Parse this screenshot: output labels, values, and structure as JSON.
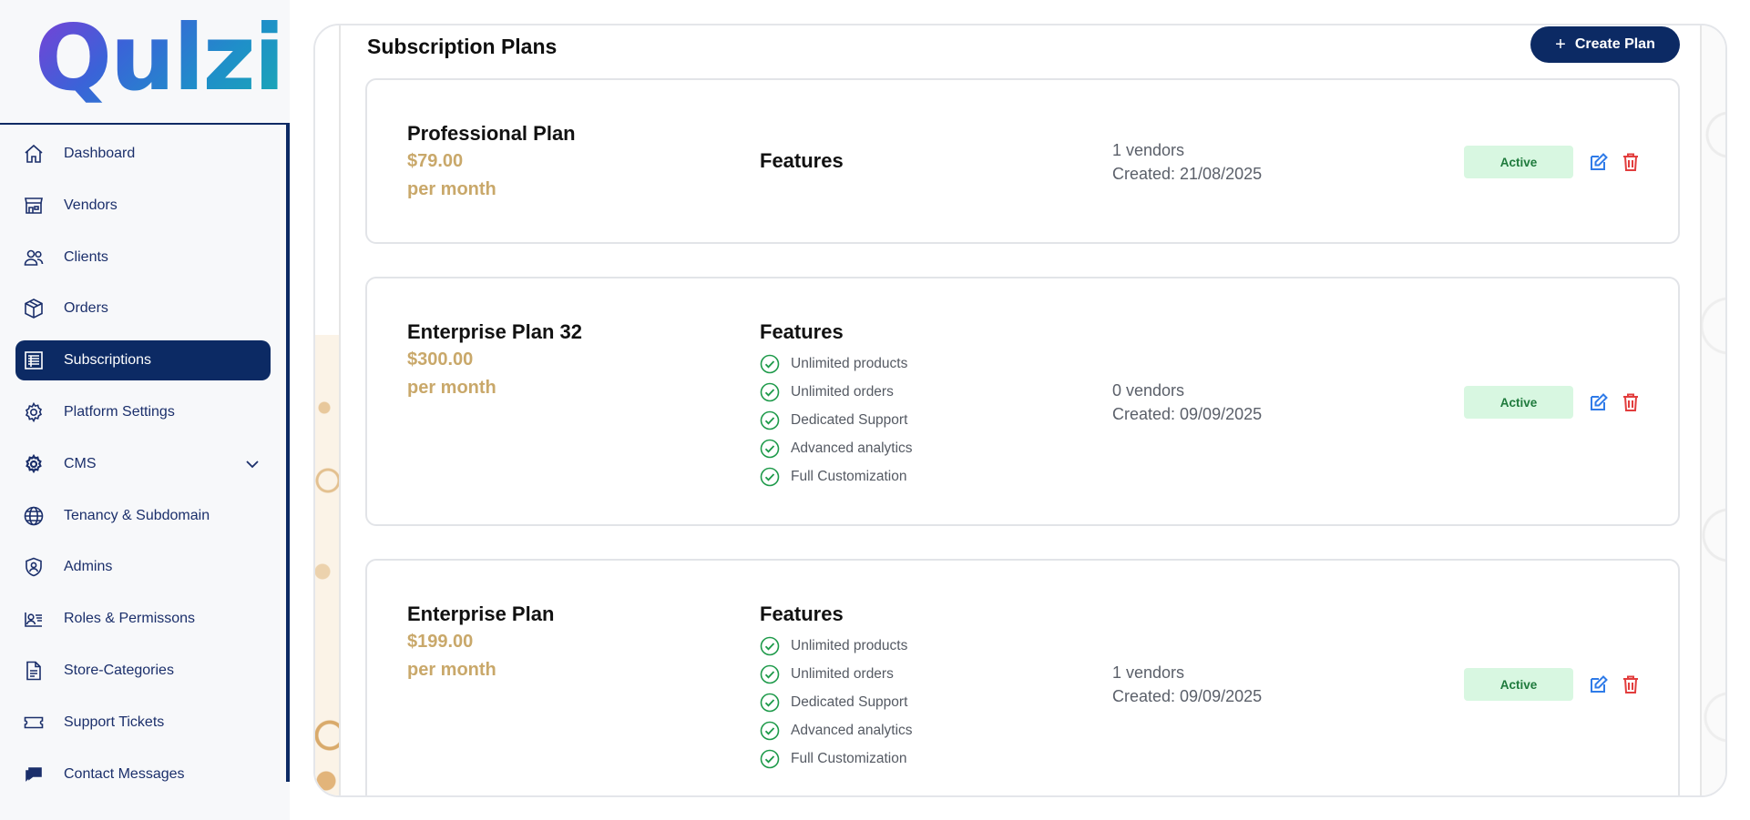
{
  "brand": {
    "logo_text": "Qulzi"
  },
  "sidebar": {
    "items": [
      {
        "label": "Dashboard",
        "icon": "home-icon",
        "active": false
      },
      {
        "label": "Vendors",
        "icon": "store-icon",
        "active": false
      },
      {
        "label": "Clients",
        "icon": "users-icon",
        "active": false
      },
      {
        "label": "Orders",
        "icon": "box-icon",
        "active": false
      },
      {
        "label": "Subscriptions",
        "icon": "receipt-icon",
        "active": true
      },
      {
        "label": "Platform Settings",
        "icon": "gear-icon",
        "active": false
      },
      {
        "label": "CMS",
        "icon": "gear-icon",
        "active": false,
        "has_submenu": true
      },
      {
        "label": "Tenancy & Subdomain",
        "icon": "globe-icon",
        "active": false
      },
      {
        "label": "Admins",
        "icon": "shield-user-icon",
        "active": false
      },
      {
        "label": "Roles & Permissons",
        "icon": "id-card-icon",
        "active": false
      },
      {
        "label": "Store-Categories",
        "icon": "document-icon",
        "active": false
      },
      {
        "label": "Support Tickets",
        "icon": "ticket-icon",
        "active": false
      },
      {
        "label": "Contact Messages",
        "icon": "chat-icon",
        "active": false
      }
    ]
  },
  "main": {
    "title": "Subscription Plans",
    "create_button_label": "Create Plan",
    "plans": [
      {
        "name": "Professional Plan",
        "price": "$79.00",
        "period": "per month",
        "features_title": "Features",
        "features": [],
        "vendors": "1 vendors",
        "created": "Created: 21/08/2025",
        "status": "Active"
      },
      {
        "name": "Enterprise Plan 32",
        "price": "$300.00",
        "period": "per month",
        "features_title": "Features",
        "features": [
          "Unlimited products",
          "Unlimited orders",
          "Dedicated Support",
          "Advanced analytics",
          "Full Customization"
        ],
        "vendors": "0 vendors",
        "created": "Created: 09/09/2025",
        "status": "Active"
      },
      {
        "name": "Enterprise Plan",
        "price": "$199.00",
        "period": "per month",
        "features_title": "Features",
        "features": [
          "Unlimited products",
          "Unlimited orders",
          "Dedicated Support",
          "Advanced analytics",
          "Full Customization"
        ],
        "vendors": "1 vendors",
        "created": "Created: 09/09/2025",
        "status": "Active"
      }
    ]
  },
  "colors": {
    "primary": "#0c2a64",
    "price": "#c9a86a",
    "badge_bg": "#d8f7e1",
    "badge_text": "#1e7a3c",
    "edit": "#2f7be8",
    "delete": "#e23d3d",
    "check": "#1e9a4a"
  }
}
